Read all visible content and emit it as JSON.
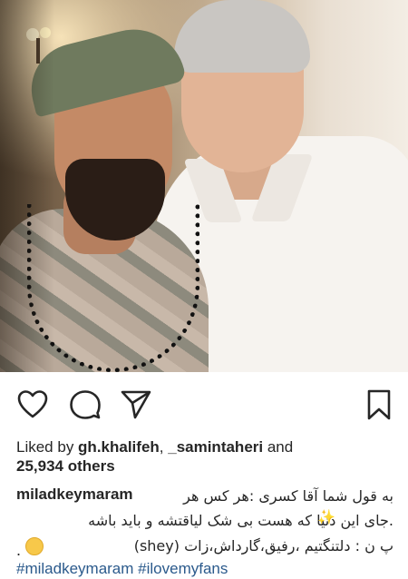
{
  "post": {
    "photo_alt": "selfie photo"
  },
  "actions": {
    "like_icon": "heart-icon",
    "comment_icon": "comment-icon",
    "share_icon": "send-icon",
    "save_icon": "bookmark-icon"
  },
  "likes": {
    "prefix": "Liked by ",
    "user1": "gh.khalifeh",
    "separator": ", ",
    "user2": "_samintaheri",
    "and": " and",
    "others_count": "25,934 others"
  },
  "caption": {
    "username": "miladkeymaram",
    "line1": "به قول شما آقا کسری :هر کس هر",
    "line2": ".جای این دنیا که هست بی شک لیاقتشه و باید باشه",
    "line3": "پ ن : دلتنگتیم ،رفیق،گارداش،زات (shey)",
    "sparkle": "✨",
    "dot": "."
  },
  "hashtags": {
    "tag1": "#miladkeymaram",
    "tag2": "#ilovemyfans"
  },
  "colors": {
    "text": "#262626",
    "hashtag": "#2b5a8c",
    "background": "#ffffff"
  }
}
